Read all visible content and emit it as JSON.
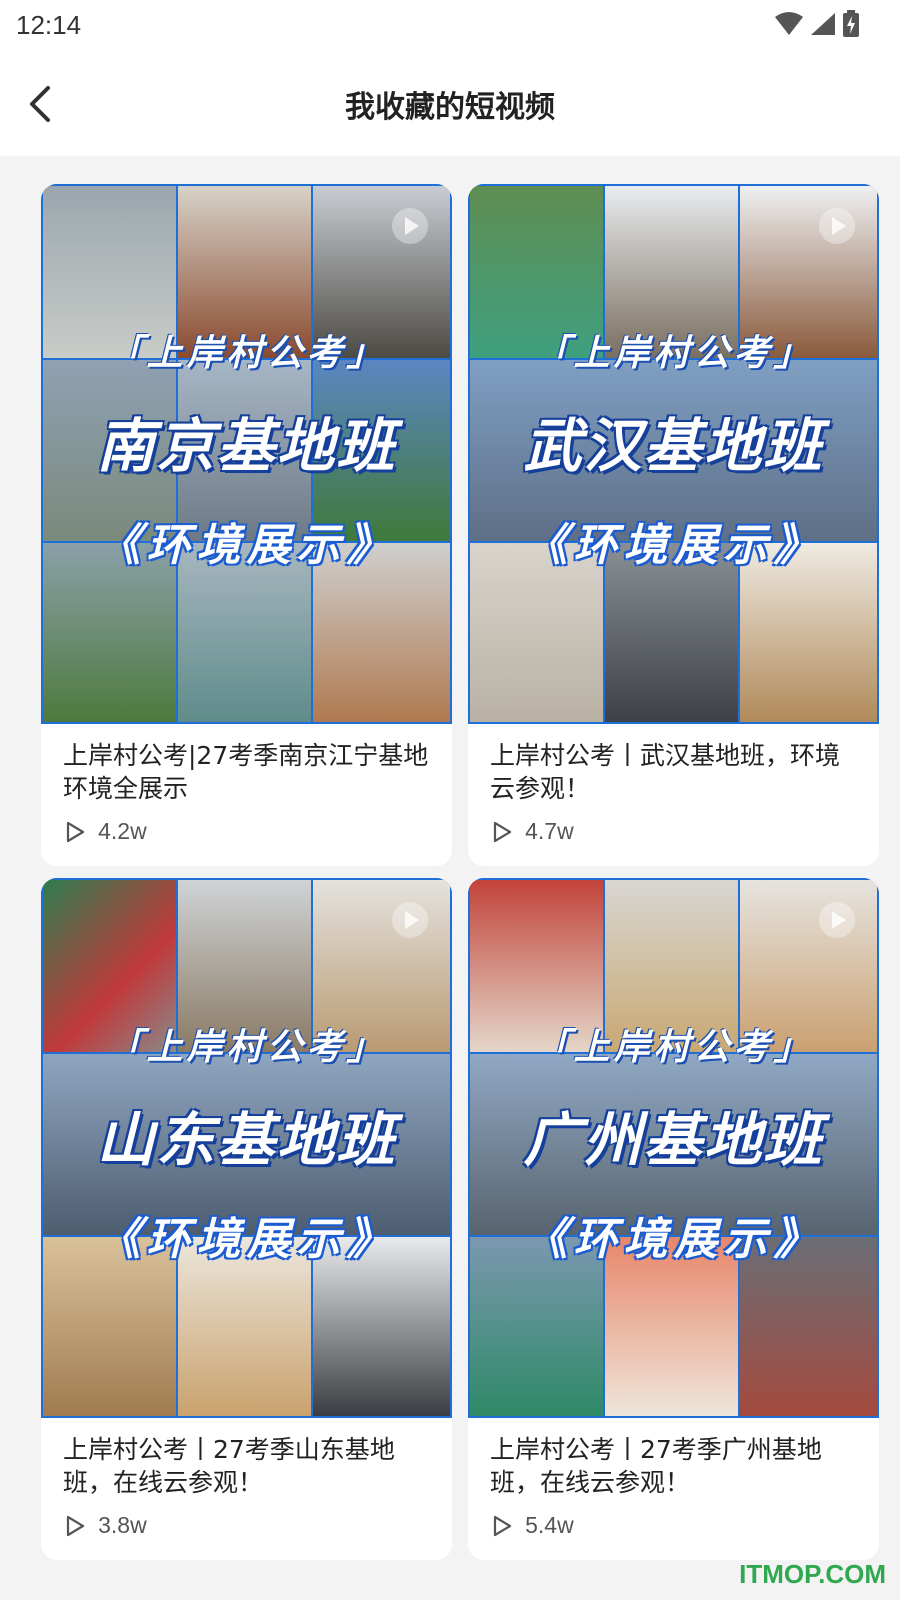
{
  "status_bar": {
    "time": "12:14"
  },
  "header": {
    "title": "我收藏的短视频"
  },
  "cards": [
    {
      "brand": "「上岸村公考」",
      "base_title": "南京基地班",
      "subtitle": "《环境展示》",
      "title": "上岸村公考|27考季南京江宁基地环境全展示",
      "views": "4.2w"
    },
    {
      "brand": "「上岸村公考」",
      "base_title": "武汉基地班",
      "subtitle": "《环境展示》",
      "title": "上岸村公考丨武汉基地班，环境云参观！",
      "views": "4.7w"
    },
    {
      "brand": "「上岸村公考」",
      "base_title": "山东基地班",
      "subtitle": "《环境展示》",
      "title": "上岸村公考丨27考季山东基地班，在线云参观！",
      "views": "3.8w"
    },
    {
      "brand": "「上岸村公考」",
      "base_title": "广州基地班",
      "subtitle": "《环境展示》",
      "title": "上岸村公考丨27考季广州基地班，在线云参观！",
      "views": "5.4w"
    }
  ],
  "watermark": "ITMOP.COM",
  "colors": {
    "accent_blue": "#1f6fd8",
    "watermark_green": "#2fa84f",
    "page_bg": "#f3f3f3"
  }
}
